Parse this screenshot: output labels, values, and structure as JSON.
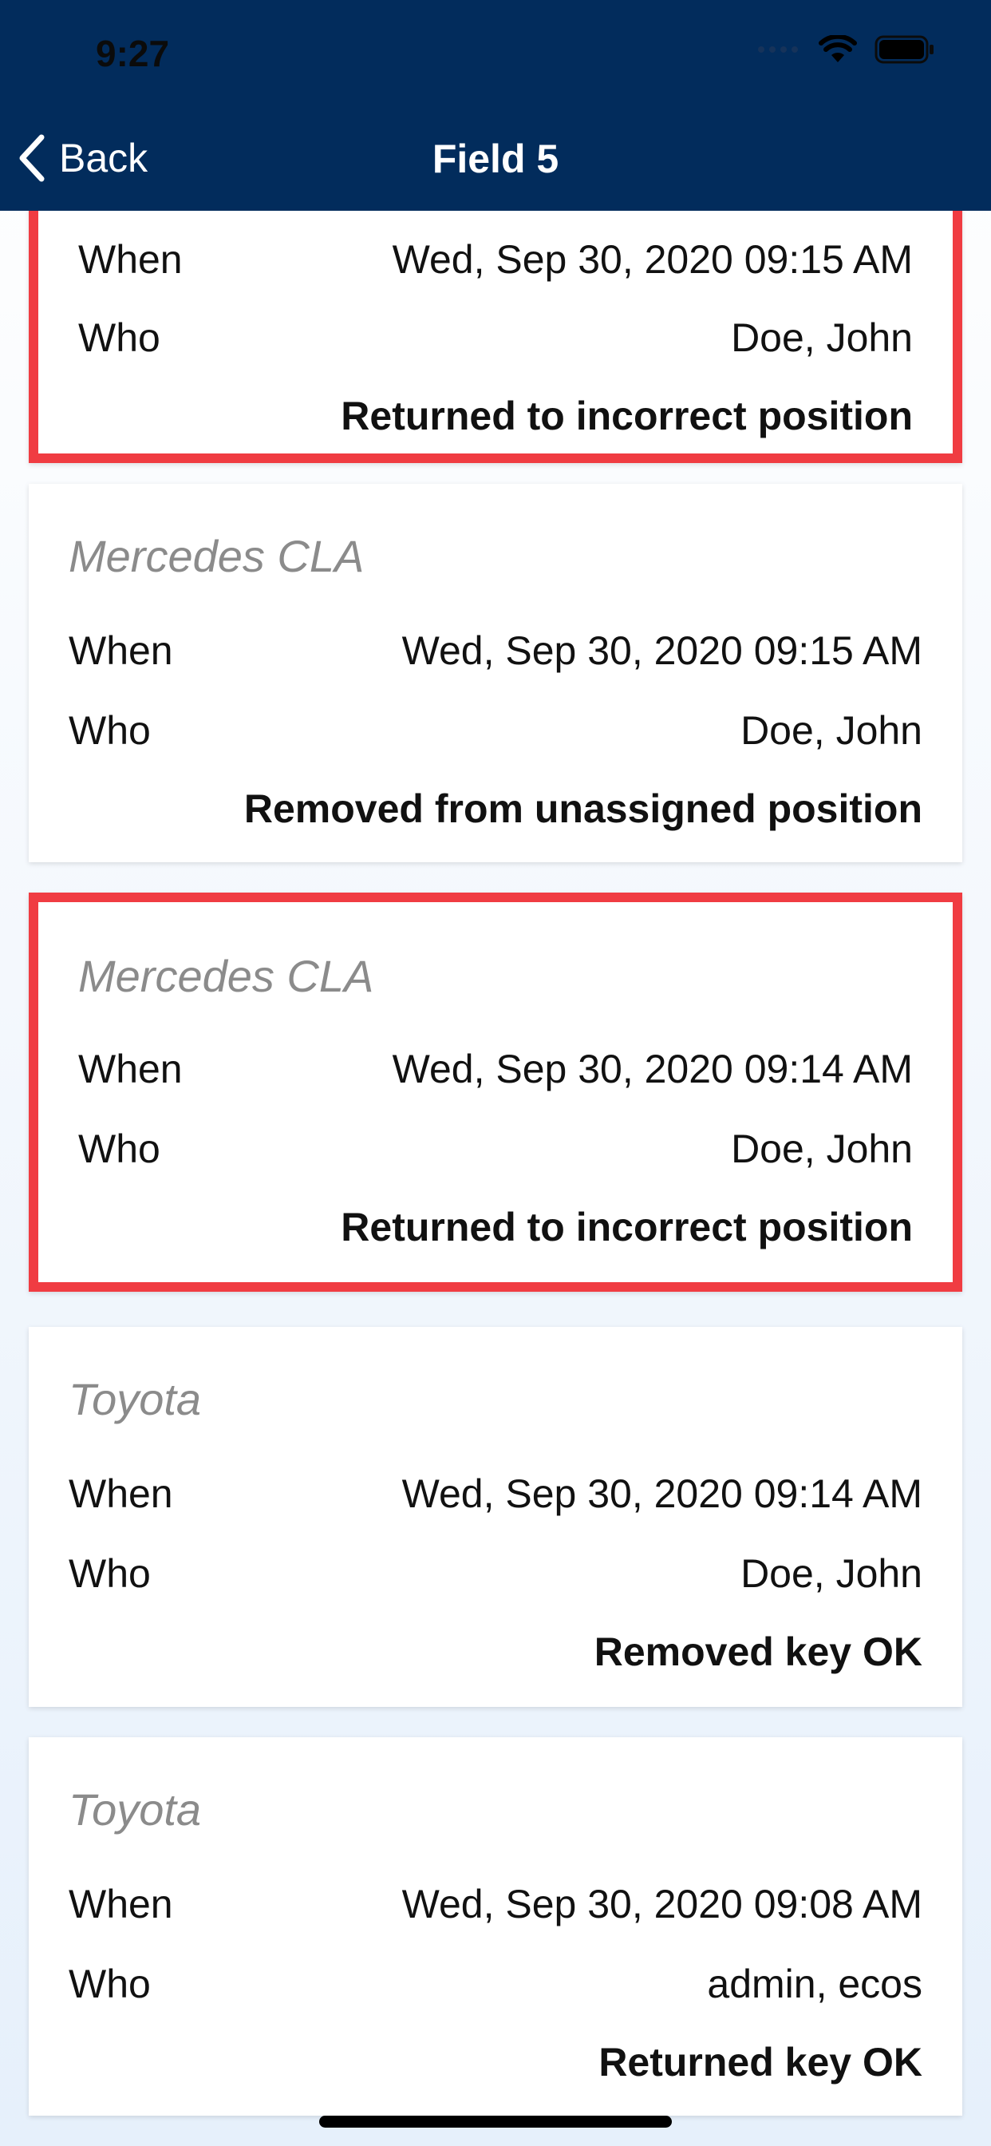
{
  "status_bar": {
    "time": "9:27"
  },
  "nav": {
    "back_label": "Back",
    "title": "Field 5"
  },
  "labels": {
    "when": "When",
    "who": "Who"
  },
  "entries": [
    {
      "car": "",
      "when": "Wed, Sep 30, 2020 09:15 AM",
      "who": "Doe, John",
      "action": "Returned to incorrect position",
      "highlighted": true
    },
    {
      "car": "Mercedes CLA",
      "when": "Wed, Sep 30, 2020 09:15 AM",
      "who": "Doe, John",
      "action": "Removed from unassigned position",
      "highlighted": false
    },
    {
      "car": "Mercedes CLA",
      "when": "Wed, Sep 30, 2020 09:14 AM",
      "who": "Doe, John",
      "action": "Returned to incorrect position",
      "highlighted": true
    },
    {
      "car": "Toyota",
      "when": "Wed, Sep 30, 2020 09:14 AM",
      "who": "Doe, John",
      "action": "Removed key OK",
      "highlighted": false
    },
    {
      "car": "Toyota",
      "when": "Wed, Sep 30, 2020 09:08 AM",
      "who": "admin, ecos",
      "action": "Returned key OK",
      "highlighted": false
    }
  ],
  "colors": {
    "nav_bg": "#022c5c",
    "highlight_border": "#f03c42",
    "car_text": "#8b8b8b"
  },
  "icons": {
    "back": "chevron-left-icon",
    "signal": "signal-icon",
    "wifi": "wifi-icon",
    "battery": "battery-icon"
  }
}
